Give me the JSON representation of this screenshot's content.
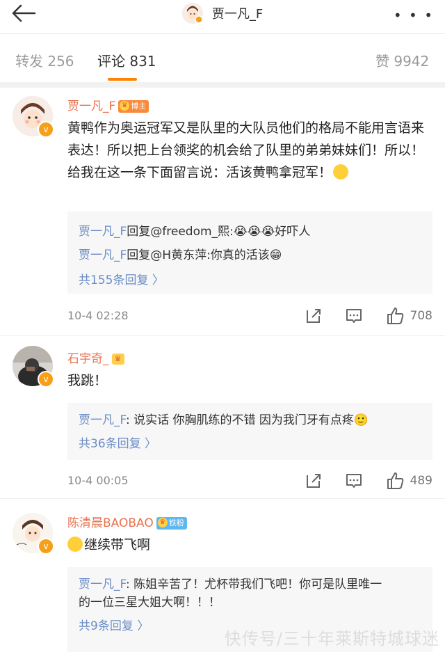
{
  "nav": {
    "title": "贾一凡_F"
  },
  "tabs": {
    "repost": "转发 256",
    "comment": "评论 831",
    "like": "赞 9942"
  },
  "comments": [
    {
      "user": "贾一凡_F",
      "tag": "博主",
      "text": "黄鸭作为奥运冠军又是队里的大队员他们的格局不能用言语来表达！所以把上台领奖的机会给了队里的弟弟妹妹们！所以！给我在这一条下面留言说：活该黄鸭拿冠军！",
      "replies": [
        {
          "user": "贾一凡_F",
          "text": "回复@freedom_熙:😭😭😭好吓人"
        },
        {
          "user": "贾一凡_F",
          "text": "回复@H黄东萍:你真的活该😁"
        }
      ],
      "more": "共155条回复 〉",
      "time": "10-4 02:28",
      "likes": "708"
    },
    {
      "user": "石宇奇_",
      "text": "我跳！",
      "replies": [
        {
          "user": "贾一凡_F",
          "text": ": 说实话 你胸肌练的不错 因为我门牙有点疼🙂"
        }
      ],
      "more": "共36条回复 〉",
      "time": "10-4 00:05",
      "likes": "489"
    },
    {
      "user": "陈清晨BAOBAO",
      "tag": "铁粉",
      "text": "继续带飞啊",
      "replies": [
        {
          "user": "贾一凡_F",
          "text": ": 陈姐辛苦了！尤杯带我们飞吧！你可是队里唯一"
        },
        {
          "user": "",
          "text": "的一位三星大姐大啊！！！"
        }
      ],
      "more": "共9条回复 〉"
    }
  ],
  "watermark": "快传号/三十年莱斯特城球迷",
  "colors": {
    "accent": "#ff8200",
    "username": "#eb7350",
    "link": "#6a8cc7",
    "verified": "#f6a01a"
  }
}
